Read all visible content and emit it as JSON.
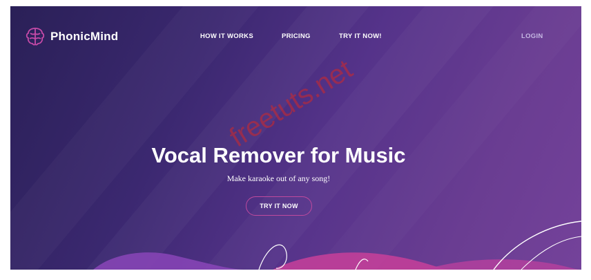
{
  "brand": {
    "name": "PhonicMind",
    "logo_icon": "brain-icon"
  },
  "nav": {
    "links": [
      "HOW IT WORKS",
      "PRICING",
      "TRY IT NOW!"
    ],
    "login": "LOGIN"
  },
  "hero": {
    "title": "Vocal Remover for Music",
    "subtitle": "Make karaoke out of any song!",
    "cta": "TRY IT NOW"
  },
  "watermark": "freetuts.net",
  "colors": {
    "background_start": "#2a2057",
    "background_end": "#74429a",
    "accent": "#c04a9e",
    "wave_pink": "#c8409a"
  }
}
